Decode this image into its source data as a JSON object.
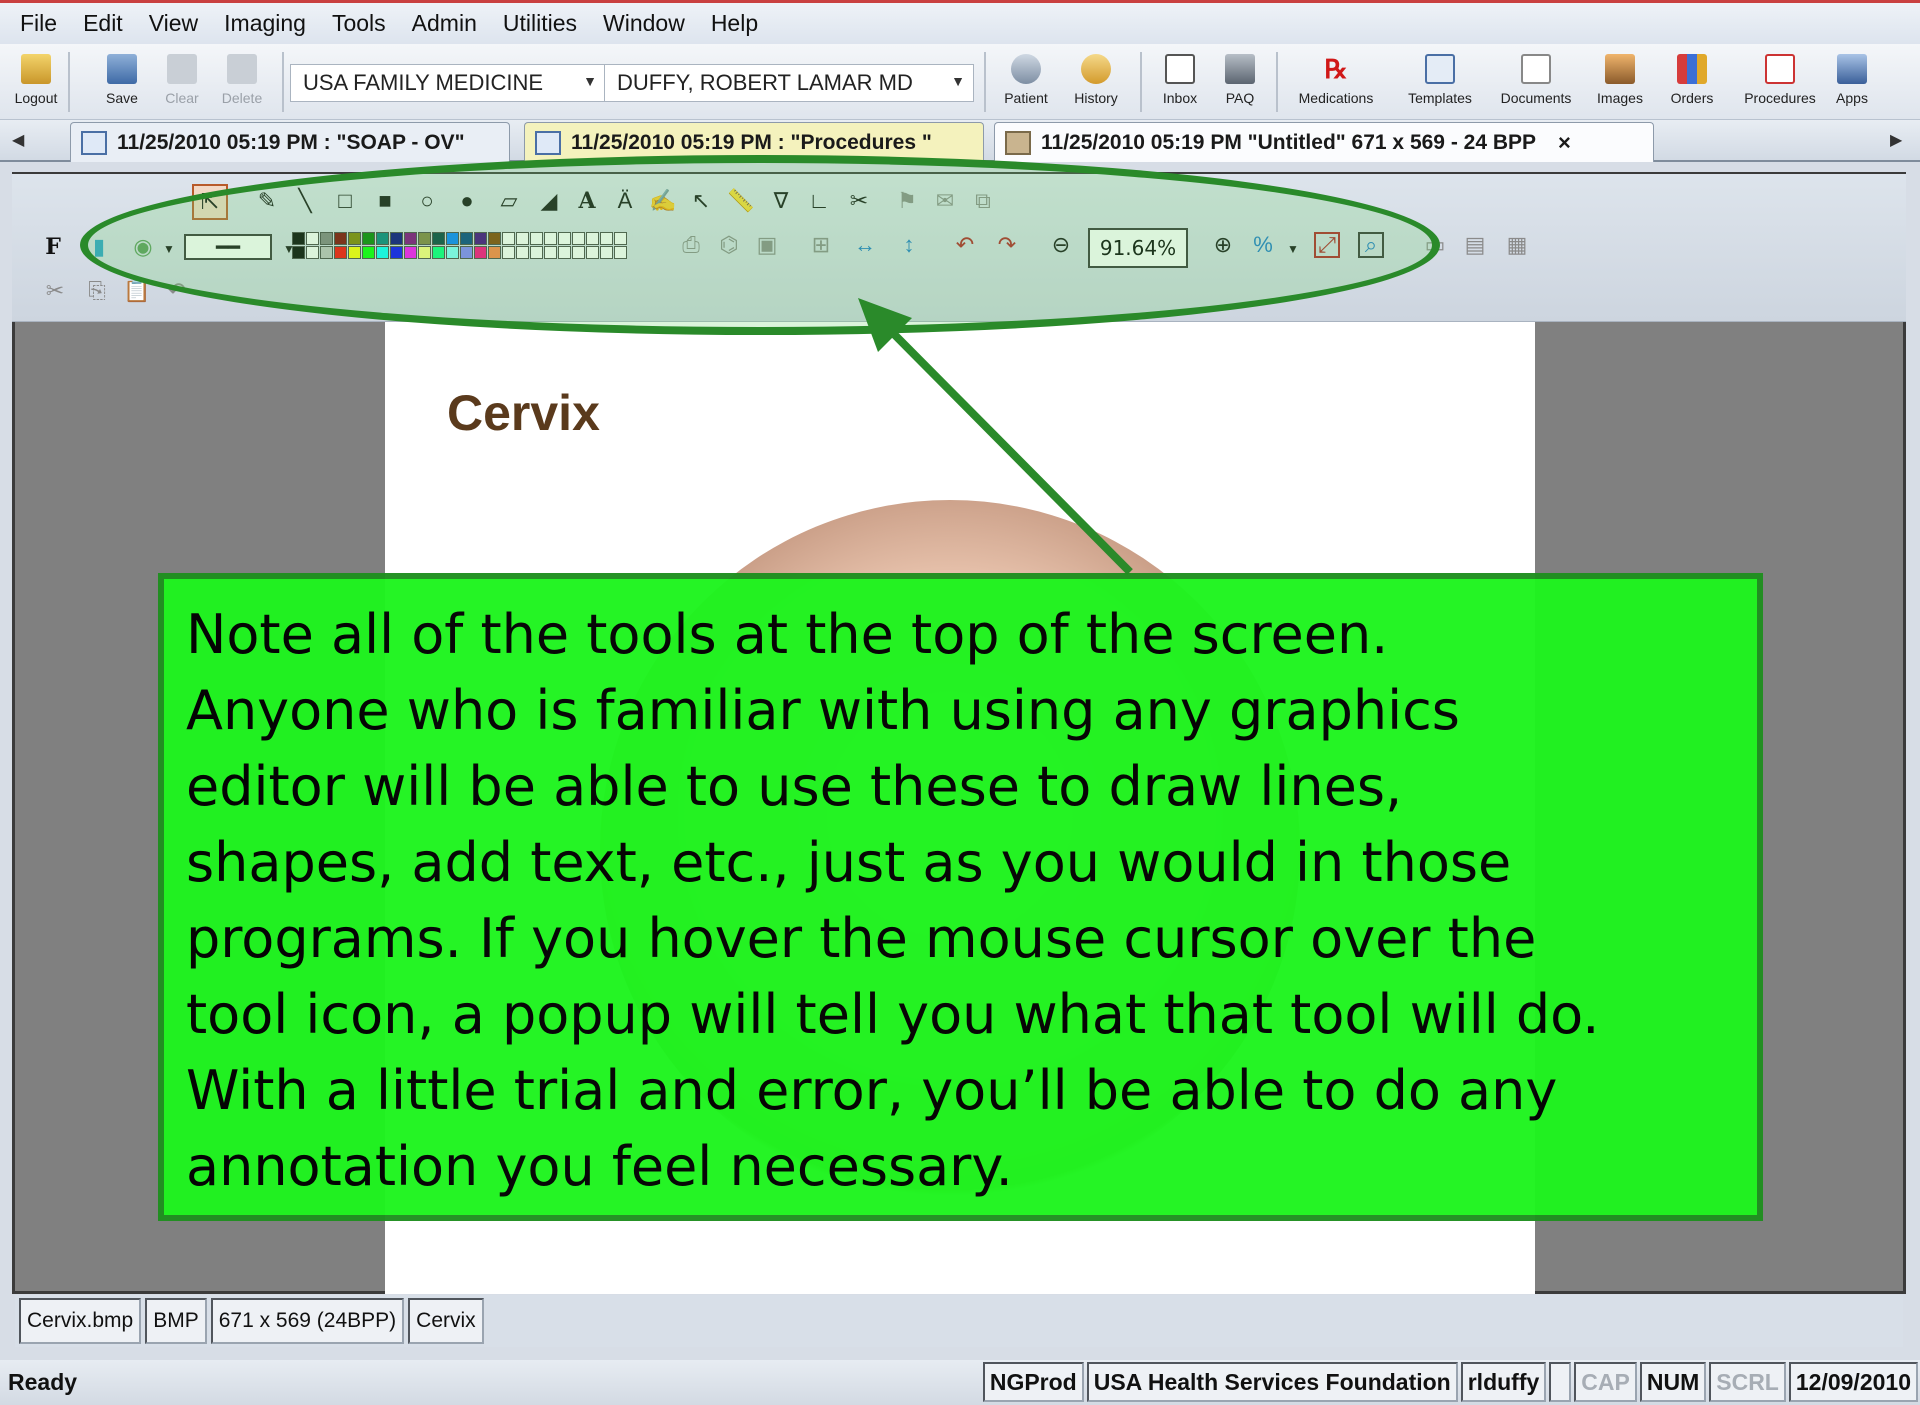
{
  "menu": [
    "File",
    "Edit",
    "View",
    "Imaging",
    "Tools",
    "Admin",
    "Utilities",
    "Window",
    "Help"
  ],
  "toolbar": {
    "left_buttons": [
      {
        "label": "Logout",
        "icon": "logout-icon",
        "enabled": true
      },
      {
        "label": "Save",
        "icon": "save-icon",
        "enabled": true
      },
      {
        "label": "Clear",
        "icon": "eraser-icon",
        "enabled": false
      },
      {
        "label": "Delete",
        "icon": "delete-icon",
        "enabled": false
      }
    ],
    "practice_combo": "USA FAMILY MEDICINE",
    "provider_combo": "DUFFY, ROBERT LAMAR MD",
    "right_buttons": [
      {
        "label": "Patient",
        "icon": "patient-icon"
      },
      {
        "label": "History",
        "icon": "history-icon"
      },
      {
        "label": "Inbox",
        "icon": "inbox-icon"
      },
      {
        "label": "PAQ",
        "icon": "paq-icon"
      },
      {
        "label": "Medications",
        "icon": "rx-icon"
      },
      {
        "label": "Templates",
        "icon": "templates-icon"
      },
      {
        "label": "Documents",
        "icon": "documents-icon"
      },
      {
        "label": "Images",
        "icon": "images-icon"
      },
      {
        "label": "Orders",
        "icon": "orders-icon"
      },
      {
        "label": "Procedures",
        "icon": "procedures-icon"
      },
      {
        "label": "Apps",
        "icon": "apps-icon"
      }
    ]
  },
  "tabs": [
    {
      "label": "11/25/2010 05:19 PM : \"SOAP - OV\"",
      "active": false
    },
    {
      "label": "11/25/2010 05:19 PM : \"Procedures \"",
      "active": false
    },
    {
      "label": "11/25/2010 05:19 PM \"Untitled\" 671 x 569 - 24 BPP",
      "active": true
    }
  ],
  "tab_close": "×",
  "image_toolbar": {
    "zoom": "91.64%",
    "percent_label": "%",
    "bold_label": "F"
  },
  "document": {
    "title": "Cervix"
  },
  "doc_status": [
    "Cervix.bmp",
    "BMP",
    "671 x 569 (24BPP)",
    "Cervix"
  ],
  "statusbar": {
    "ready": "Ready",
    "cells": [
      {
        "text": "NGProd",
        "off": false
      },
      {
        "text": "USA Health Services Foundation",
        "off": false
      },
      {
        "text": "rlduffy",
        "off": false
      },
      {
        "text": "",
        "off": false
      },
      {
        "text": "CAP",
        "off": true
      },
      {
        "text": "NUM",
        "off": false
      },
      {
        "text": "SCRL",
        "off": true
      },
      {
        "text": "12/09/2010",
        "off": false
      }
    ]
  },
  "callout": {
    "lines": [
      "Note all of the tools at the top of the screen.",
      "Anyone who is familiar with using any graphics",
      "editor will be able to use these to draw lines,",
      "shapes, add text, etc., just as you would in those",
      "programs.  If you hover the mouse cursor over the",
      "tool icon, a popup will tell you what that tool will do.",
      "With a little trial and error, you’ll be able to do any",
      "annotation you feel necessary."
    ]
  },
  "colors": {
    "callout_bg": "#1ef41e",
    "callout_border": "#1f8f1f",
    "ellipse_stroke": "#2a8a2a"
  }
}
